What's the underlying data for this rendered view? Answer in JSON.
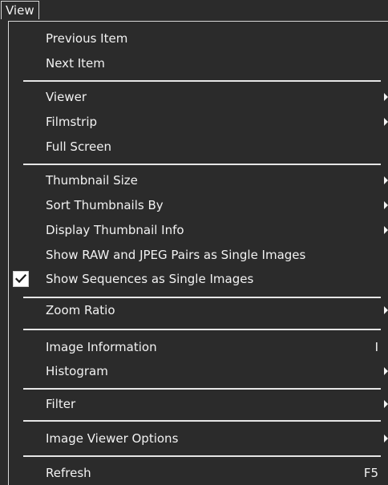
{
  "menubar": {
    "title": "View"
  },
  "menu": {
    "items": [
      {
        "label": "Previous Item"
      },
      {
        "label": "Next Item"
      },
      {
        "label": "Viewer",
        "submenu": true
      },
      {
        "label": "Filmstrip",
        "submenu": true
      },
      {
        "label": "Full Screen"
      },
      {
        "label": "Thumbnail Size",
        "submenu": true
      },
      {
        "label": "Sort Thumbnails By",
        "submenu": true
      },
      {
        "label": "Display Thumbnail Info",
        "submenu": true
      },
      {
        "label": "Show RAW and JPEG Pairs as Single Images"
      },
      {
        "label": "Show Sequences as Single Images",
        "checked": true
      },
      {
        "label": "Zoom Ratio",
        "submenu": true
      },
      {
        "label": "Image Information",
        "shortcut": "I"
      },
      {
        "label": "Histogram",
        "submenu": true
      },
      {
        "label": "Filter",
        "submenu": true
      },
      {
        "label": "Image Viewer Options",
        "submenu": true
      },
      {
        "label": "Refresh",
        "shortcut": "F5"
      }
    ]
  },
  "colors": {
    "background": "#2b2b2b",
    "text": "#f2f2f2",
    "separator": "#e6e6e6",
    "checkbox": "#ffffff",
    "checkmark": "#1a1a1a"
  },
  "icons": {
    "submenu": "chevron-right-icon",
    "check": "checkmark-icon"
  }
}
